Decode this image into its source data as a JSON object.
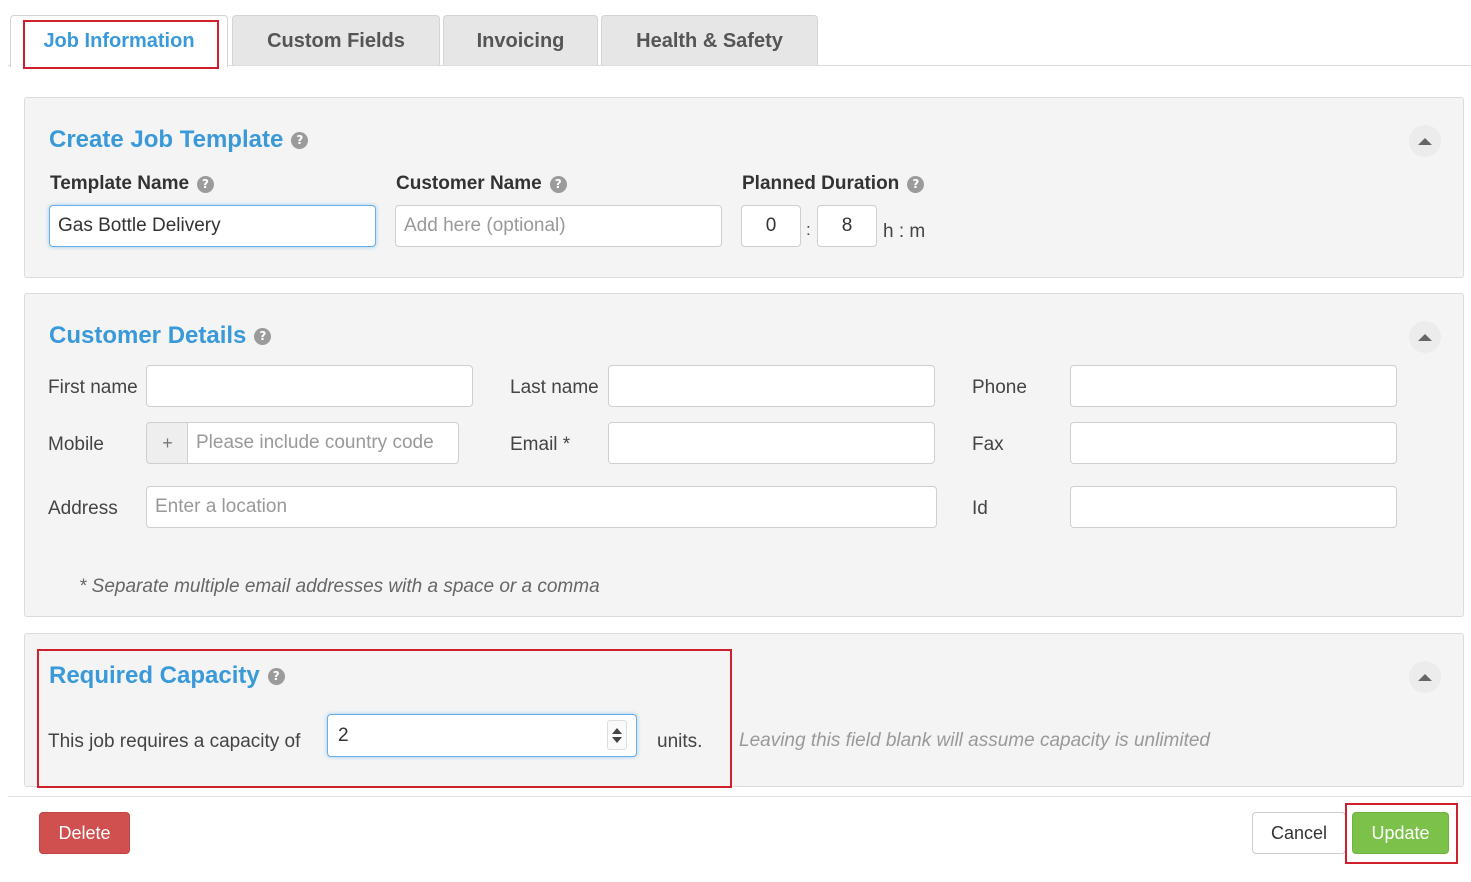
{
  "tabs": [
    {
      "label": "Job Information",
      "active": true
    },
    {
      "label": "Custom Fields",
      "active": false
    },
    {
      "label": "Invoicing",
      "active": false
    },
    {
      "label": "Health & Safety",
      "active": false
    }
  ],
  "job_template": {
    "title": "Create Job Template",
    "template_name_label": "Template Name",
    "template_name_value": "Gas Bottle Delivery",
    "customer_name_label": "Customer Name",
    "customer_name_placeholder": "Add here (optional)",
    "planned_duration_label": "Planned Duration",
    "duration_hours": "0",
    "duration_separator": ":",
    "duration_minutes": "8",
    "duration_unit": "h : m"
  },
  "customer_details": {
    "title": "Customer Details",
    "first_name_label": "First name",
    "last_name_label": "Last name",
    "phone_label": "Phone",
    "mobile_label": "Mobile",
    "mobile_prefix": "+",
    "mobile_placeholder": "Please include country code",
    "email_label": "Email *",
    "fax_label": "Fax",
    "address_label": "Address",
    "address_placeholder": "Enter a location",
    "id_label": "Id",
    "email_note": "* Separate multiple email addresses with a space or a comma"
  },
  "capacity": {
    "title": "Required Capacity",
    "prefix": "This job requires a capacity of",
    "value": "2",
    "suffix": "units.",
    "hint": "Leaving this field blank will assume capacity is unlimited"
  },
  "footer": {
    "delete_label": "Delete",
    "cancel_label": "Cancel",
    "update_label": "Update"
  },
  "icons": {
    "help": "help-icon",
    "collapse": "chevron-up-icon"
  },
  "colors": {
    "accent": "#3a9ad9",
    "danger": "#d05050",
    "success": "#7cc24a",
    "highlight": "#d0202e"
  }
}
